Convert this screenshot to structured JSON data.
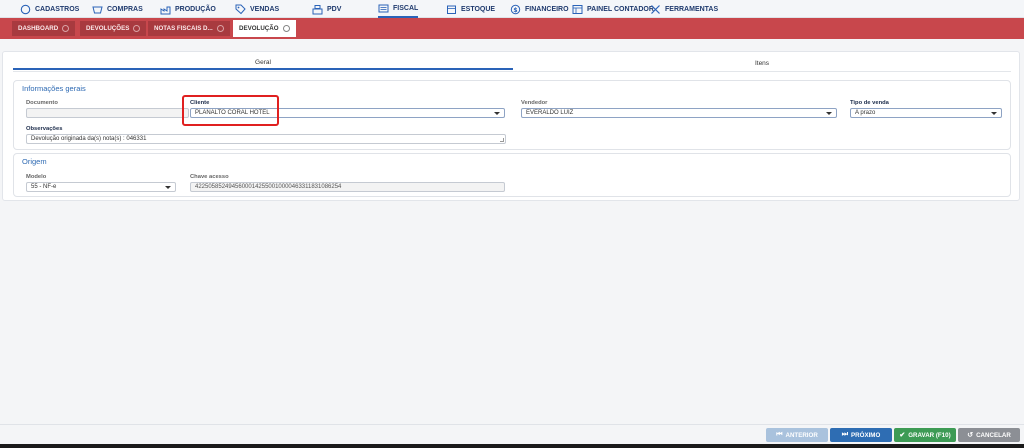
{
  "top_menu": {
    "items": [
      {
        "label": "CADASTROS",
        "icon": "circle-icon"
      },
      {
        "label": "COMPRAS",
        "icon": "basket-icon"
      },
      {
        "label": "PRODUÇÃO",
        "icon": "factory-icon"
      },
      {
        "label": "VENDAS",
        "icon": "tag-icon"
      },
      {
        "label": "PDV",
        "icon": "register-icon"
      },
      {
        "label": "FISCAL",
        "icon": "document-icon"
      },
      {
        "label": "ESTOQUE",
        "icon": "box-icon"
      },
      {
        "label": "FINANCEIRO",
        "icon": "dollar-icon"
      },
      {
        "label": "PAINEL CONTADOR",
        "icon": "panel-icon"
      },
      {
        "label": "FERRAMENTAS",
        "icon": "tools-icon"
      }
    ],
    "active_index": 5
  },
  "tabs": [
    {
      "label": "DASHBOARD"
    },
    {
      "label": "DEVOLUÇÕES"
    },
    {
      "label": "NOTAS FISCAIS D..."
    },
    {
      "label": "DEVOLUÇÃO"
    }
  ],
  "subtabs": {
    "geral": "Geral",
    "itens": "Itens"
  },
  "info_gerais": {
    "title": "Informações gerais",
    "documento_label": "Documento",
    "documento_value": "",
    "cliente_label": "Cliente",
    "cliente_value": "PLANALTO CORAL HOTEL",
    "vendedor_label": "Vendedor",
    "vendedor_value": "EVERALDO LUIZ",
    "tipo_venda_label": "Tipo de venda",
    "tipo_venda_value": "A prazo",
    "observacoes_label": "Observações",
    "observacoes_value": "Devolução originada da(s) nota(s) : 046331"
  },
  "origem": {
    "title": "Origem",
    "modelo_label": "Modelo",
    "modelo_value": "55 - NF-e",
    "chave_label": "Chave acesso",
    "chave_value": "42250585249456000142550010000463311831086254"
  },
  "buttons": {
    "anterior": "ANTERIOR",
    "proximo": "PRÓXIMO",
    "gravar": "GRAVAR (F10)",
    "cancelar": "CANCELAR"
  },
  "colors": {
    "tabbar": "#c8474c",
    "accent": "#2e6ab3",
    "highlight": "#e02020",
    "gravar": "#3d9b55"
  }
}
